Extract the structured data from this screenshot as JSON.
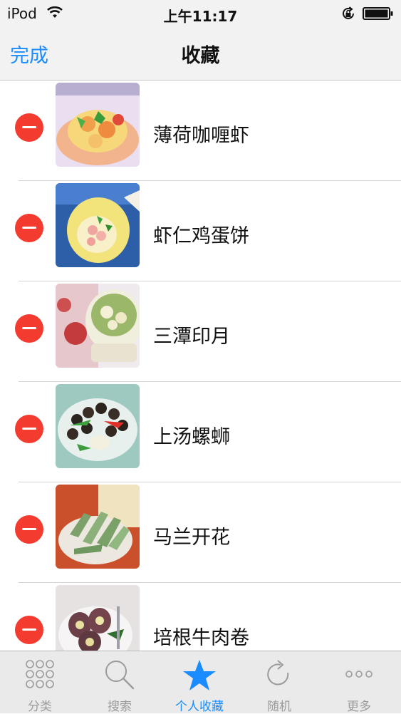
{
  "status_bar": {
    "carrier": "iPod",
    "time": "上午11:17"
  },
  "nav": {
    "done_label": "完成",
    "title": "收藏"
  },
  "favorites": [
    {
      "name": "薄荷咖喱虾"
    },
    {
      "name": "虾仁鸡蛋饼"
    },
    {
      "name": "三潭印月"
    },
    {
      "name": "上汤螺蛳"
    },
    {
      "name": "马兰开花"
    },
    {
      "name": "培根牛肉卷"
    }
  ],
  "tabs": [
    {
      "label": "分类",
      "icon": "grid-icon",
      "active": false
    },
    {
      "label": "搜索",
      "icon": "search-icon",
      "active": false
    },
    {
      "label": "个人收藏",
      "icon": "star-icon",
      "active": true
    },
    {
      "label": "随机",
      "icon": "refresh-icon",
      "active": false
    },
    {
      "label": "更多",
      "icon": "more-icon",
      "active": false
    }
  ],
  "colors": {
    "accent": "#1a8cff",
    "delete": "#f43b2f",
    "inactive": "#9b9b9b"
  }
}
